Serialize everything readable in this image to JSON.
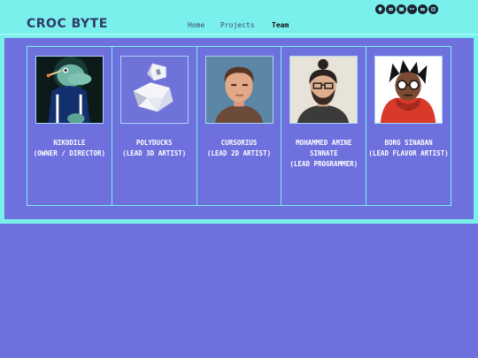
{
  "header": {
    "logo": "CROC BYTE",
    "nav": [
      {
        "label": "Home"
      },
      {
        "label": "Projects"
      },
      {
        "label": "Team"
      }
    ],
    "socials": [
      "github-icon",
      "discord-icon",
      "itch-icon",
      "bluesky-icon",
      "youtube-icon",
      "instagram-icon"
    ]
  },
  "team": [
    {
      "name": "NIKODILE",
      "role": "(OWNER / DIRECTOR)",
      "avatar": "crocodile-avatar"
    },
    {
      "name": "POLYDUCKS",
      "role": "(LEAD 3D ARTIST)",
      "avatar": "low-poly-duck-avatar"
    },
    {
      "name": "CURSORIUS",
      "role": "(LEAD 2D ARTIST)",
      "avatar": "man-portrait-avatar"
    },
    {
      "name": "MOHAMMED AMINE SINNATE",
      "role": "(LEAD PROGRAMMER)",
      "avatar": "man-with-bun-avatar"
    },
    {
      "name": "BORG SINABAN",
      "role": "(LEAD FLAVOR ARTIST)",
      "avatar": "cartoon-hoodie-avatar"
    }
  ]
}
